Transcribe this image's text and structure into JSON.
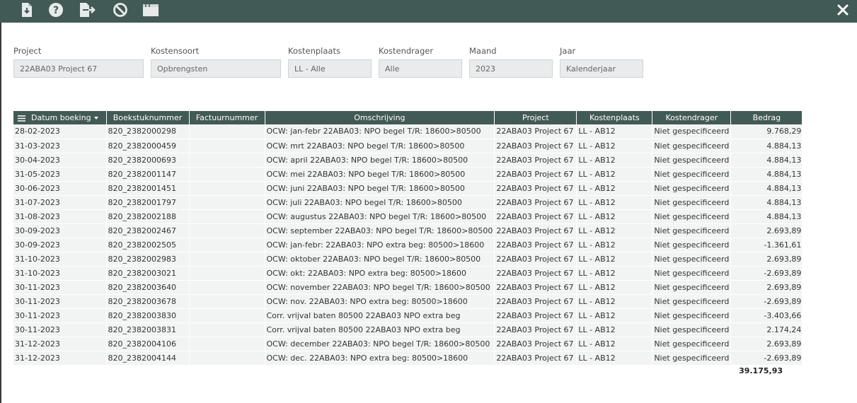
{
  "filters": [
    {
      "label": "Project",
      "value": "22ABA03 Project 67"
    },
    {
      "label": "Kostensoort",
      "value": "Opbrengsten"
    },
    {
      "label": "Kostenplaats",
      "value": "LL - Alle"
    },
    {
      "label": "Kostendrager",
      "value": "Alle"
    },
    {
      "label": "Maand",
      "value": "2023"
    },
    {
      "label": "Jaar",
      "value": "Kalenderjaar"
    }
  ],
  "table": {
    "columns": [
      "Datum boeking",
      "Boekstuknummer",
      "Factuurnummer",
      "Omschrijving",
      "Project",
      "Kostenplaats",
      "Kostendrager",
      "Bedrag"
    ],
    "rows": [
      [
        "28-02-2023",
        "820_2382000298",
        "",
        "OCW: jan-febr 22ABA03: NPO begel T/R: 18600>80500",
        "22ABA03 Project 67",
        "LL - AB12",
        "Niet gespecificeerd",
        "9.768,29"
      ],
      [
        "31-03-2023",
        "820_2382000459",
        "",
        "OCW: mrt 22ABA03: NPO begel T/R: 18600>80500",
        "22ABA03 Project 67",
        "LL - AB12",
        "Niet gespecificeerd",
        "4.884,13"
      ],
      [
        "30-04-2023",
        "820_2382000693",
        "",
        "OCW: april 22ABA03: NPO begel T/R: 18600>80500",
        "22ABA03 Project 67",
        "LL - AB12",
        "Niet gespecificeerd",
        "4.884,13"
      ],
      [
        "31-05-2023",
        "820_2382001147",
        "",
        "OCW: mei 22ABA03: NPO begel T/R: 18600>80500",
        "22ABA03 Project 67",
        "LL - AB12",
        "Niet gespecificeerd",
        "4.884,13"
      ],
      [
        "30-06-2023",
        "820_2382001451",
        "",
        "OCW: juni 22ABA03: NPO begel T/R: 18600>80500",
        "22ABA03 Project 67",
        "LL - AB12",
        "Niet gespecificeerd",
        "4.884,13"
      ],
      [
        "31-07-2023",
        "820_2382001797",
        "",
        "OCW: juli 22ABA03: NPO begel T/R: 18600>80500",
        "22ABA03 Project 67",
        "LL - AB12",
        "Niet gespecificeerd",
        "4.884,13"
      ],
      [
        "31-08-2023",
        "820_2382002188",
        "",
        "OCW: augustus 22ABA03: NPO begel T/R: 18600>80500",
        "22ABA03 Project 67",
        "LL - AB12",
        "Niet gespecificeerd",
        "4.884,13"
      ],
      [
        "30-09-2023",
        "820_2382002467",
        "",
        "OCW: september 22ABA03: NPO begel T/R: 18600>80500",
        "22ABA03 Project 67",
        "LL - AB12",
        "Niet gespecificeerd",
        "2.693,89"
      ],
      [
        "30-09-2023",
        "820_2382002505",
        "",
        "OCW: jan-febr: 22ABA03: NPO extra beg: 80500>18600",
        "22ABA03 Project 67",
        "LL - AB12",
        "Niet gespecificeerd",
        "-1.361,61"
      ],
      [
        "31-10-2023",
        "820_2382002983",
        "",
        "OCW: oktober 22ABA03: NPO begel T/R: 18600>80500",
        "22ABA03 Project 67",
        "LL - AB12",
        "Niet gespecificeerd",
        "2.693,89"
      ],
      [
        "31-10-2023",
        "820_2382003021",
        "",
        "OCW: okt: 22ABA03: NPO extra beg: 80500>18600",
        "22ABA03 Project 67",
        "LL - AB12",
        "Niet gespecificeerd",
        "-2.693,89"
      ],
      [
        "30-11-2023",
        "820_2382003640",
        "",
        "OCW: november 22ABA03: NPO begel T/R: 18600>80500",
        "22ABA03 Project 67",
        "LL - AB12",
        "Niet gespecificeerd",
        "2.693,89"
      ],
      [
        "30-11-2023",
        "820_2382003678",
        "",
        "OCW: nov. 22ABA03: NPO extra beg: 80500>18600",
        "22ABA03 Project 67",
        "LL - AB12",
        "Niet gespecificeerd",
        "-2.693,89"
      ],
      [
        "30-11-2023",
        "820_2382003830",
        "",
        "Corr. vrijval baten 80500 22ABA03 NPO extra beg",
        "22ABA03 Project 67",
        "LL - AB12",
        "Niet gespecificeerd",
        "-3.403,66"
      ],
      [
        "30-11-2023",
        "820_2382003831",
        "",
        "Corr. vrijval baten 80500 22ABA03 NPO extra beg",
        "22ABA03 Project 67",
        "LL - AB12",
        "Niet gespecificeerd",
        "2.174,24"
      ],
      [
        "31-12-2023",
        "820_2382004106",
        "",
        "OCW: december 22ABA03: NPO begel T/R: 18600>80500",
        "22ABA03 Project 67",
        "LL - AB12",
        "Niet gespecificeerd",
        "2.693,89"
      ],
      [
        "31-12-2023",
        "820_2382004144",
        "",
        "OCW: dec. 22ABA03: NPO extra beg: 80500>18600",
        "22ABA03 Project 67",
        "LL - AB12",
        "Niet gespecificeerd",
        "-2.693,89"
      ]
    ],
    "total": "39.175,93"
  },
  "colors": {
    "toolbar": "#425a55",
    "header": "#425a55",
    "row": "#f2f3f3",
    "input": "#e9ebec"
  }
}
